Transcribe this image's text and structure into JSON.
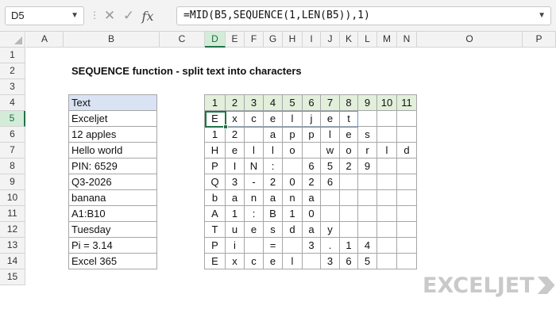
{
  "formula_bar": {
    "name_box": "D5",
    "cancel_icon": "✕",
    "confirm_icon": "✓",
    "fx_label": "fx",
    "formula": "=MID(B5,SEQUENCE(1,LEN(B5)),1)"
  },
  "columns": [
    "A",
    "B",
    "C",
    "D",
    "E",
    "F",
    "G",
    "H",
    "I",
    "J",
    "K",
    "L",
    "M",
    "N",
    "O",
    "P"
  ],
  "selected_column": "D",
  "rows": [
    "1",
    "2",
    "3",
    "4",
    "5",
    "6",
    "7",
    "8",
    "9",
    "10",
    "11",
    "12",
    "13",
    "14",
    "15"
  ],
  "selected_row": "5",
  "sheet": {
    "title": "SEQUENCE function - split text into characters",
    "table_header": "Text",
    "texts": [
      "Exceljet",
      "12 apples",
      "Hello world",
      "PIN: 6529",
      "Q3-2026",
      "banana",
      "A1:B10",
      "Tuesday",
      "Pi = 3.14",
      "Excel 365"
    ],
    "seq_header": [
      "1",
      "2",
      "3",
      "4",
      "5",
      "6",
      "7",
      "8",
      "9",
      "10",
      "11"
    ],
    "char_grid": [
      [
        "E",
        "x",
        "c",
        "e",
        "l",
        "j",
        "e",
        "t",
        "",
        "",
        ""
      ],
      [
        "1",
        "2",
        "",
        "a",
        "p",
        "p",
        "l",
        "e",
        "s",
        "",
        ""
      ],
      [
        "H",
        "e",
        "l",
        "l",
        "o",
        "",
        "w",
        "o",
        "r",
        "l",
        "d"
      ],
      [
        "P",
        "I",
        "N",
        ":",
        "",
        "6",
        "5",
        "2",
        "9",
        "",
        ""
      ],
      [
        "Q",
        "3",
        "-",
        "2",
        "0",
        "2",
        "6",
        "",
        "",
        "",
        ""
      ],
      [
        "b",
        "a",
        "n",
        "a",
        "n",
        "a",
        "",
        "",
        "",
        "",
        ""
      ],
      [
        "A",
        "1",
        ":",
        "B",
        "1",
        "0",
        "",
        "",
        "",
        "",
        ""
      ],
      [
        "T",
        "u",
        "e",
        "s",
        "d",
        "a",
        "y",
        "",
        "",
        "",
        ""
      ],
      [
        "P",
        "i",
        "",
        "=",
        "",
        "3",
        ".",
        "1",
        "4",
        "",
        ""
      ],
      [
        "E",
        "x",
        "c",
        "e",
        "l",
        "",
        "3",
        "6",
        "5",
        "",
        ""
      ]
    ]
  },
  "colors": {
    "excel_green": "#217346",
    "text_table_header_fill": "#dae3f3",
    "seq_header_fill": "#e2efda",
    "spill_border": "#6a97d1",
    "logo_gray": "#c9c9c9"
  },
  "logo": {
    "text": "EXCELJET",
    "icon": "exceljet-arrow-icon"
  }
}
